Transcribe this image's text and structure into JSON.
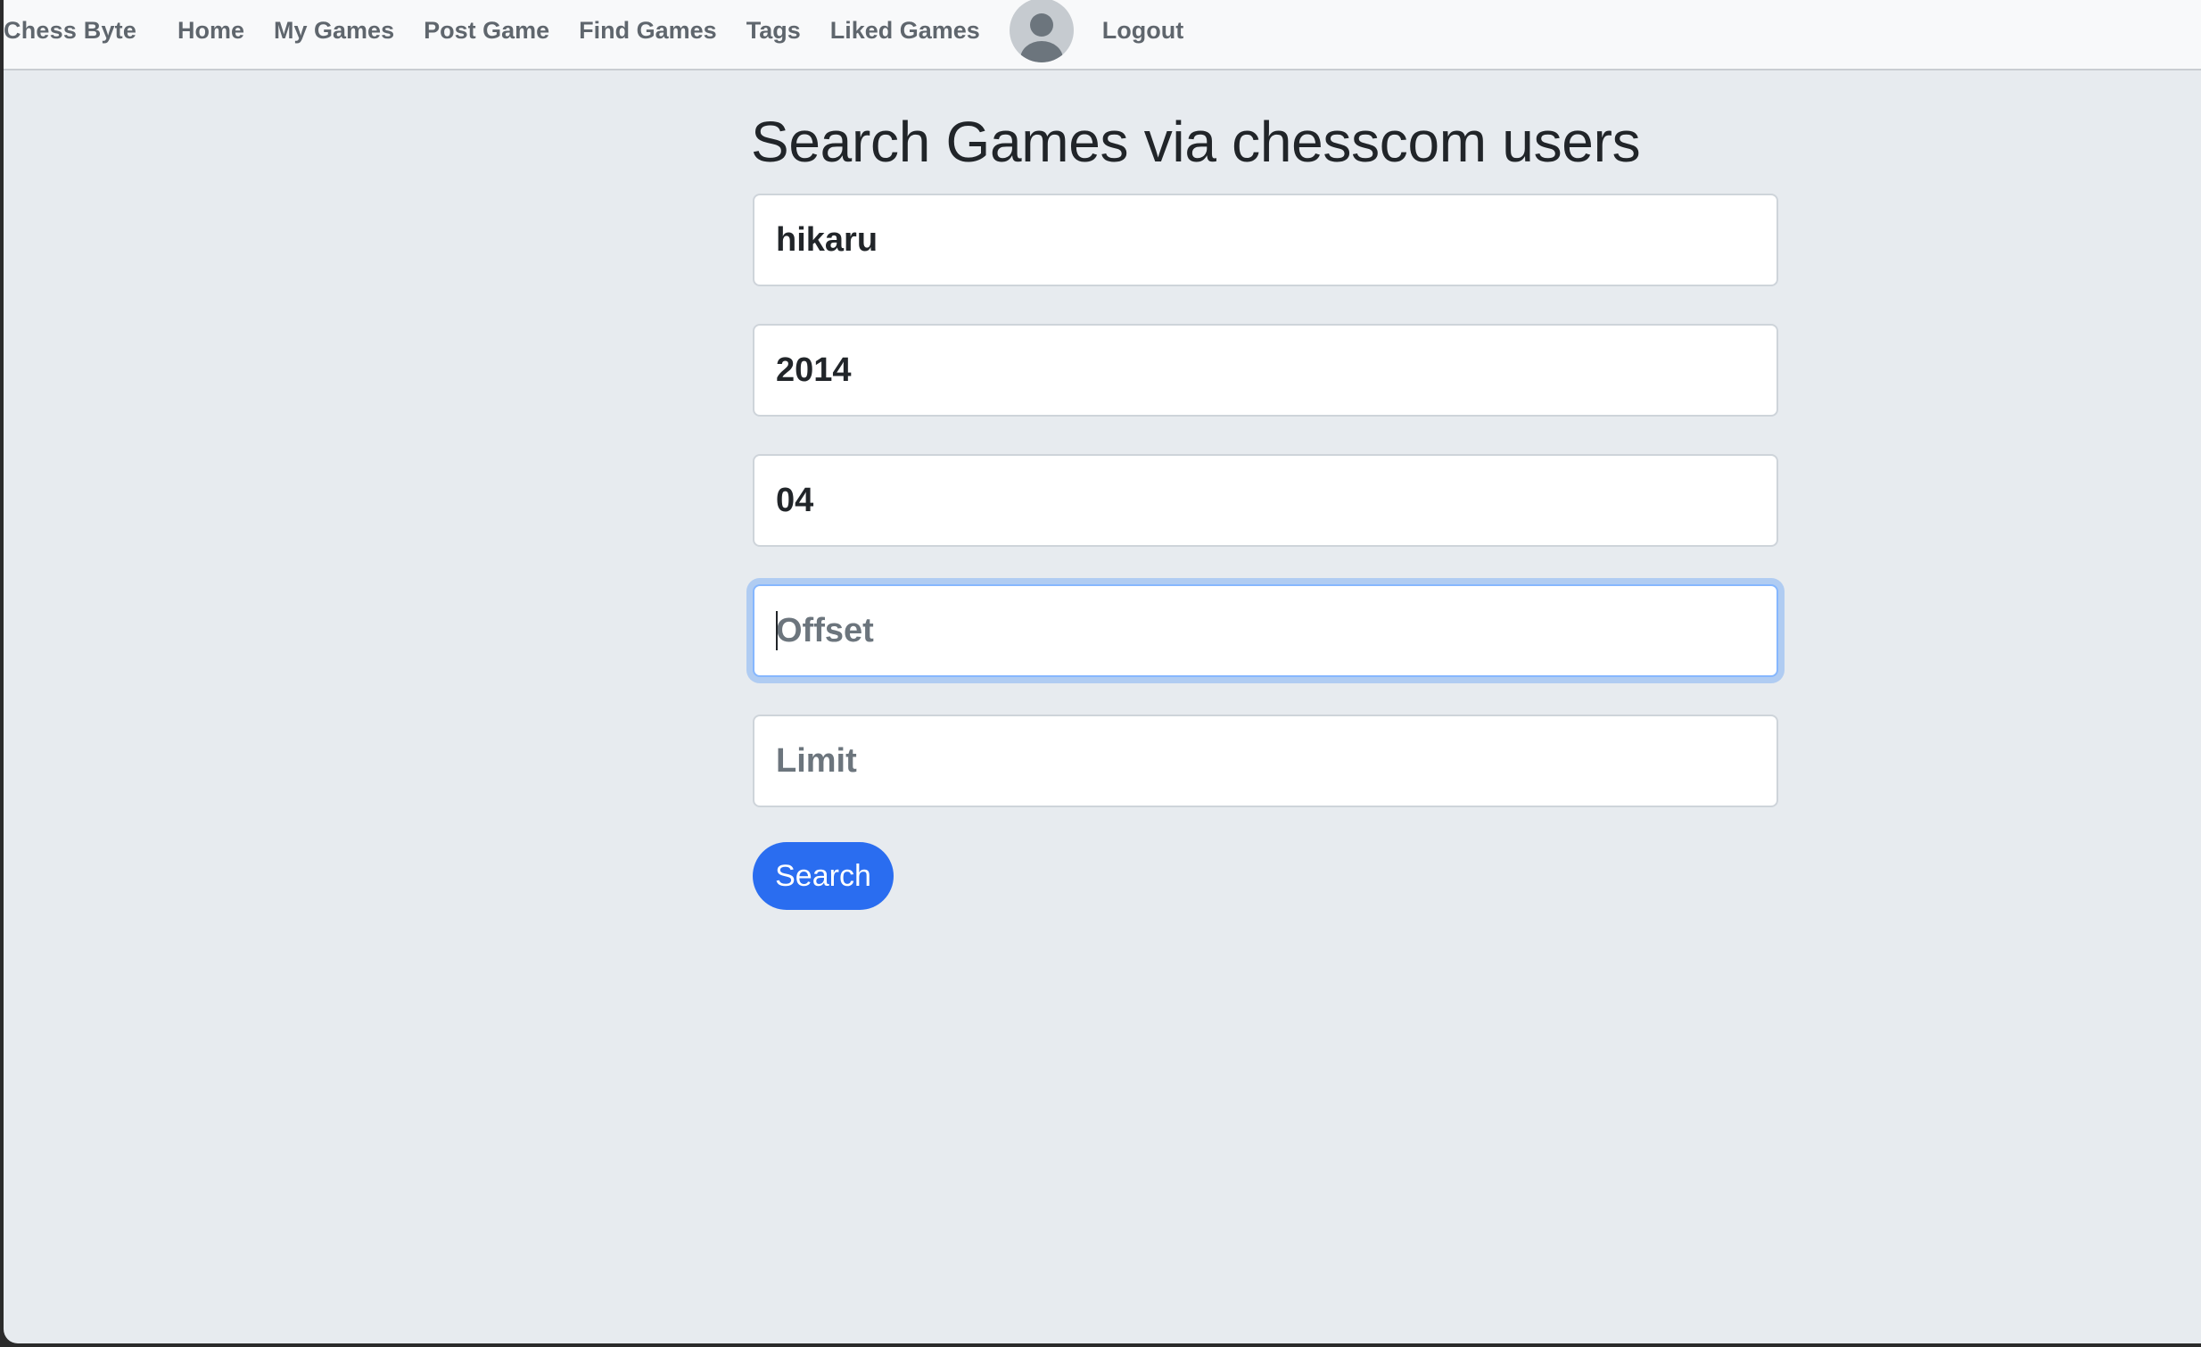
{
  "navbar": {
    "brand": "Chess Byte",
    "links": {
      "home": "Home",
      "my_games": "My Games",
      "post_game": "Post Game",
      "find_games": "Find Games",
      "tags": "Tags",
      "liked_games": "Liked Games",
      "logout": "Logout"
    },
    "avatar_icon": "user-avatar-icon"
  },
  "main": {
    "title": "Search Games via chesscom users",
    "fields": {
      "username": {
        "value": "hikaru",
        "placeholder": ""
      },
      "year": {
        "value": "2014",
        "placeholder": ""
      },
      "month": {
        "value": "04",
        "placeholder": ""
      },
      "offset": {
        "value": "",
        "placeholder": "Offset"
      },
      "limit": {
        "value": "",
        "placeholder": "Limit"
      }
    },
    "search_button": "Search"
  },
  "colors": {
    "page_background": "#e7ebef",
    "navbar_background": "#f8f9fa",
    "primary_button": "#2a6df0",
    "focus_ring": "#86b7fe",
    "nav_text": "#5f666d"
  }
}
